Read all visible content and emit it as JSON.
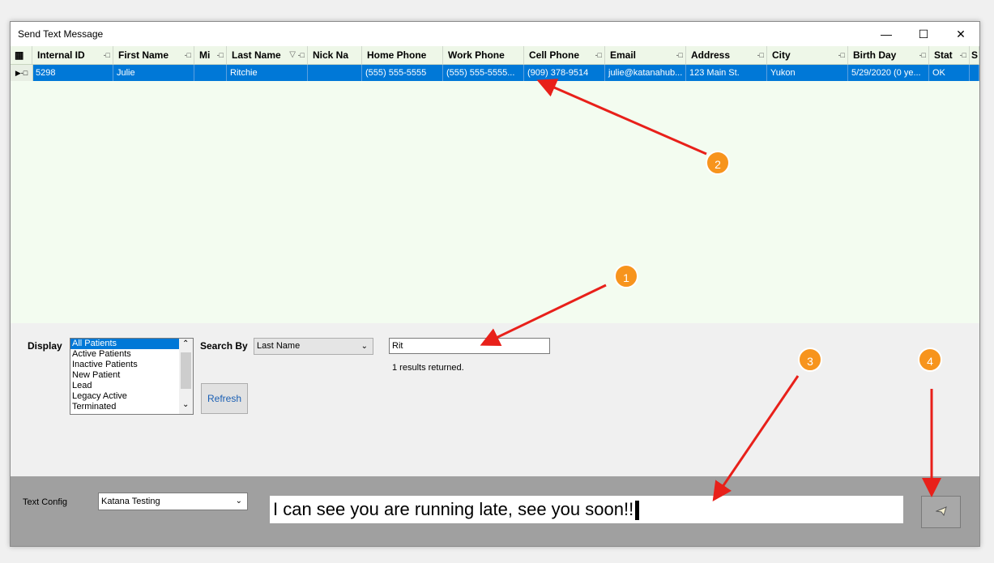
{
  "window": {
    "title": "Send Text Message",
    "minimize_icon": "minimize-icon",
    "maximize_icon": "maximize-icon",
    "close_icon": "close-icon"
  },
  "grid": {
    "columns": [
      "Internal ID",
      "First Name",
      "Mi",
      "Last Name",
      "Nick Na",
      "Home Phone",
      "Work Phone",
      "Cell Phone",
      "Email",
      "Address",
      "City",
      "Birth Day",
      "Stat",
      "S"
    ],
    "rows": [
      [
        "5298",
        "Julie",
        "",
        "Ritchie",
        "",
        "(555) 555-5555",
        "(555)  555-5555...",
        "(909) 378-9514",
        "julie@katanahub...",
        "123 Main St.",
        "Yukon",
        "5/29/2020  (0 ye...",
        "OK",
        ""
      ]
    ]
  },
  "filters": {
    "display_label": "Display",
    "display_options": [
      "All Patients",
      "Active Patients",
      "Inactive Patients",
      "New Patient",
      "Lead",
      "Legacy Active",
      "Terminated"
    ],
    "display_selected": "All Patients",
    "search_by_label": "Search By",
    "search_by_value": "Last Name",
    "search_value": "Rit",
    "results_text": "1 results returned.",
    "refresh_label": "Refresh"
  },
  "compose": {
    "text_config_label": "Text Config",
    "text_config_value": "Katana Testing",
    "message": "I can see you are running late, see you soon!!",
    "send_icon": "paper-plane-icon"
  },
  "annotations": [
    "1",
    "2",
    "3",
    "4"
  ],
  "colors": {
    "selection": "#0078d7",
    "badge": "#f7941d",
    "arrow": "#e8201a",
    "grid_bg": "#f3fcf0"
  }
}
